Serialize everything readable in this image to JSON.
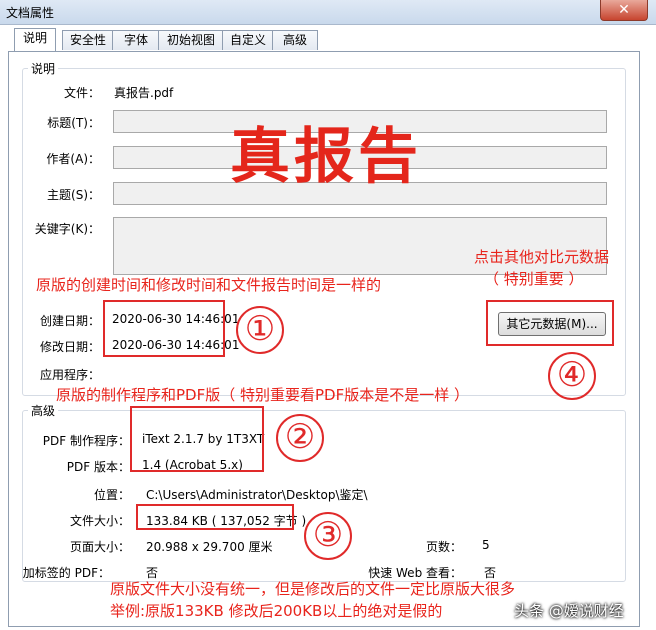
{
  "window": {
    "title": "文档属性",
    "close_glyph": "✕"
  },
  "tabs": [
    {
      "label": "说明",
      "active": true
    },
    {
      "label": "安全性",
      "active": false
    },
    {
      "label": "字体",
      "active": false
    },
    {
      "label": "初始视图",
      "active": false
    },
    {
      "label": "自定义",
      "active": false
    },
    {
      "label": "高级",
      "active": false
    }
  ],
  "description": {
    "group_label": "说明",
    "file_label": "文件：",
    "file_value": "真报告.pdf",
    "title_label": "标题(T)：",
    "author_label": "作者(A)：",
    "subject_label": "主题(S)：",
    "keywords_label": "关键字(K)：",
    "created_label": "创建日期：",
    "created_value": "2020-06-30 14:46:01",
    "modified_label": "修改日期：",
    "modified_value": "2020-06-30 14:46:01",
    "app_label": "应用程序：",
    "metadata_button": "其它元数据(M)..."
  },
  "advanced": {
    "group_label": "高级",
    "producer_label": "PDF 制作程序：",
    "producer_value": "iText 2.1.7 by 1T3XT",
    "version_label": "PDF 版本：",
    "version_value": "1.4 (Acrobat 5.x)",
    "location_label": "位置：",
    "location_value": "C:\\Users\\Administrator\\Desktop\\鉴定\\",
    "filesize_label": "文件大小：",
    "filesize_value": "133.84 KB ( 137,052 字节 )",
    "pagesize_label": "页面大小：",
    "pagesize_value": "20.988 x 29.700 厘米",
    "pages_label": "页数：",
    "pages_value": "5",
    "tagged_label": "加标签的 PDF：",
    "tagged_value": "否",
    "fastweb_label": "快速 Web 查看：",
    "fastweb_value": "否"
  },
  "annotations": {
    "big_title": "真报告",
    "note_dates": "原版的创建时间和修改时间和文件报告时间是一样的",
    "note_metadata_line1": "点击其他对比元数据",
    "note_metadata_line2": "（ 特别重要 ）",
    "note_producer": "原版的制作程序和PDF版（ 特别重要看PDF版本是不是一样 ）",
    "note_size_line1": "原版文件大小没有统一，但是修改后的文件一定比原版大很多",
    "note_size_line2": "举例:原版133KB 修改后200KB以上的绝对是假的",
    "circle1": "①",
    "circle2": "②",
    "circle3": "③",
    "circle4": "④",
    "watermark": "头条 @嫒说财经",
    "accent_color": "#e4261b"
  }
}
